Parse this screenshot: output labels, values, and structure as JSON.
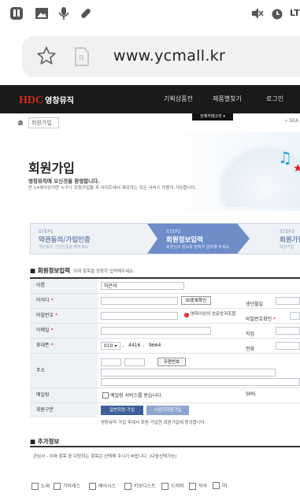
{
  "browser": {
    "url": "www.ycmall.kr",
    "carrier": "LT"
  },
  "site": {
    "logo": "HDC",
    "logo_kr": "영창뮤직",
    "nav": [
      "기획상품전",
      "제품별찾기",
      "로그인"
    ],
    "breadcrumb": "회원가입",
    "all_menu": "전체카테고리",
    "search": "SEA"
  },
  "banner": {
    "title": "회원가입",
    "welcome": "영창뮤직에 오신것을 환영합니다.",
    "desc": "만 14세이상이면 누구나 회원가입을 후 사이트에서 제공하는 모든 서비스 이용이 가능합니다."
  },
  "steps": [
    {
      "num": "STEP1",
      "title": "약관동의/가입인증",
      "sub": "약관동의 가입인증을 해주세요"
    },
    {
      "num": "STEP2",
      "title": "회원정보입력",
      "sub": "회원님의 정보를 정확히 입력해 주세요"
    },
    {
      "num": "STEP3",
      "title": "회원가입",
      "sub": "회원가입"
    }
  ],
  "section1": {
    "title": "회원정보입력",
    "hint": "아래 항목을 정확히 입력해주세요."
  },
  "form": {
    "name_label": "이름",
    "name_value": "허은석",
    "id_label": "아이디",
    "id_check": "ID중복확인",
    "birth_label": "생년월일",
    "pw_label": "비밀번호",
    "pw_hint": "영자이상의 숫문숫자조합",
    "pw_confirm_label": "비밀번호확인",
    "email_label": "이메일",
    "job_label": "직업",
    "mobile_label": "휴대폰",
    "mobile_prefix": "010",
    "mobile_mid": "4416",
    "mobile_last": "9664",
    "phone_label": "전화",
    "address_label": "주소",
    "zip_button": "우편번호",
    "newsletter_label": "메일링",
    "newsletter_check": "메일링 서비스를 받습니다.",
    "sms_label": "SMS",
    "member_type_label": "회원구분",
    "member_btn_general": "일반회원 가입",
    "member_btn_business": "사업자회원가입",
    "member_type_note": "영창뮤직 가입 후에서 회원 가입한 회원가입에 동의합니다."
  },
  "section2": {
    "title": "추가정보",
    "note": "관심사 - 이래 항목 중 다양하는 항목은 선택해 주시기 바랍니다. (다중선택가능)",
    "interests": [
      "노래",
      "기타레스",
      "베이시스",
      "키보디스트",
      "드러머",
      "작곡",
      "DJ"
    ]
  }
}
